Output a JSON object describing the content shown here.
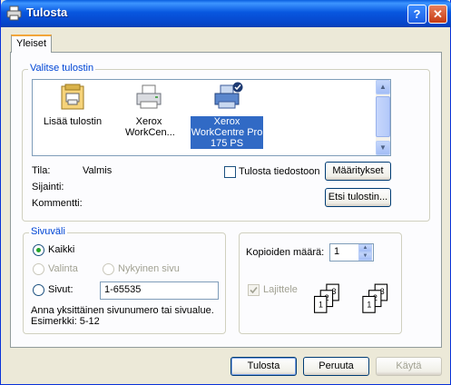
{
  "window": {
    "title": "Tulosta"
  },
  "tabs": [
    {
      "label": "Yleiset"
    }
  ],
  "printer_group": {
    "label": "Valitse tulostin",
    "printers": [
      {
        "label": "Lisää tulostin"
      },
      {
        "label": "Xerox WorkCen..."
      },
      {
        "label": "Xerox WorkCentre Pro 175 PS"
      }
    ],
    "status_label": "Tila:",
    "status_value": "Valmis",
    "location_label": "Sijainti:",
    "comment_label": "Kommentti:",
    "print_to_file": "Tulosta tiedostoon",
    "preferences_button": "Määritykset",
    "find_printer_button": "Etsi tulostin..."
  },
  "range_group": {
    "label": "Sivuväli",
    "all": "Kaikki",
    "selection": "Valinta",
    "current_page": "Nykyinen sivu",
    "pages": "Sivut:",
    "pages_value": "1-65535",
    "hint_line1": "Anna yksittäinen sivunumero tai sivualue.",
    "hint_line2": "Esimerkki: 5-12"
  },
  "copies_group": {
    "copies_label": "Kopioiden määrä:",
    "copies_value": "1",
    "collate": "Lajittele"
  },
  "footer": {
    "print_button": "Tulosta",
    "cancel_button": "Peruuta",
    "apply_button": "Käytä"
  },
  "icons": {
    "title": "printer-icon",
    "add_printer": "add-printer-wizard-icon",
    "printer": "printer-icon",
    "default_check": "default-printer-check-icon"
  },
  "colors": {
    "titlebar": "#0a57e0",
    "group_label": "#0046d5",
    "selection": "#316ac5"
  }
}
